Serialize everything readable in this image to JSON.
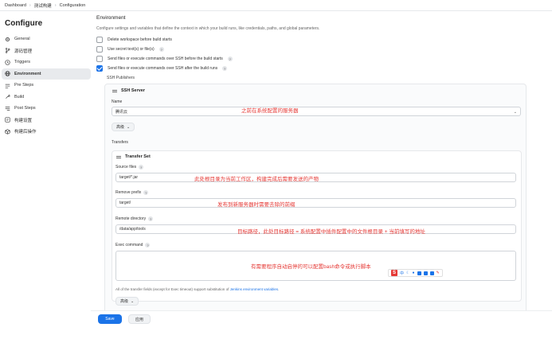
{
  "breadcrumb": [
    "Dashboard",
    "测试构建",
    "Configuration"
  ],
  "sidebar": {
    "title": "Configure",
    "items": [
      {
        "label": "General",
        "icon": "gear-icon",
        "active": false
      },
      {
        "label": "源码管理",
        "icon": "branch-icon",
        "active": false
      },
      {
        "label": "Triggers",
        "icon": "clock-icon",
        "active": false
      },
      {
        "label": "Environment",
        "icon": "globe-icon",
        "active": true
      },
      {
        "label": "Pre Steps",
        "icon": "steps-icon",
        "active": false
      },
      {
        "label": "Build",
        "icon": "build-icon",
        "active": false
      },
      {
        "label": "Post Steps",
        "icon": "post-steps-icon",
        "active": false
      },
      {
        "label": "构建设置",
        "icon": "settings-icon",
        "active": false
      },
      {
        "label": "构建后操作",
        "icon": "cube-icon",
        "active": false
      }
    ]
  },
  "environment": {
    "title": "Environment",
    "description": "Configure settings and variables that define the context in which your build runs, like credentials, paths, and global parameters.",
    "options": [
      {
        "label": "Delete workspace before build starts",
        "checked": false,
        "help": false
      },
      {
        "label": "Use secret text(s) or file(s)",
        "checked": false,
        "help": true
      },
      {
        "label": "Send files or execute commands over SSH before the build starts",
        "checked": false,
        "help": true
      },
      {
        "label": "Send files or execute commands over SSH after the build runs",
        "checked": true,
        "help": true
      }
    ],
    "ssh_publishers_label": "SSH Publishers"
  },
  "ssh_server": {
    "title": "SSH Server",
    "name_label": "Name",
    "name_value": "腾讯云",
    "advanced_label": "高级",
    "transfers_label": "Transfers",
    "name_note": "之前在系统配置的服务器"
  },
  "transfer_set": {
    "title": "Transfer Set",
    "source_files": {
      "label": "Source files",
      "value": "target/*.jar",
      "note": "此处根目录为当前工作区，构建完成后需要发送的产物"
    },
    "remove_prefix": {
      "label": "Remove prefix",
      "value": "target/",
      "note": "发布到新服务器时需要去除的前缀"
    },
    "remote_directory": {
      "label": "Remote directory",
      "value": "/data/app/tools",
      "note": "目标路径，此处目标路径 = 系统配置中插件配置中的文件根目录 + 当前填写的地址"
    },
    "exec_command": {
      "label": "Exec command",
      "value": "",
      "note": "有需要程序自动启停的可以配置bash命令或执行脚本"
    },
    "footnote_prefix": "All of the transfer fields (except for Exec timeout) support substitution of ",
    "footnote_link": "Jenkins environment variables",
    "footnote_suffix": ".",
    "advanced_label": "高级"
  },
  "ime_toolbar": {
    "logo": "S",
    "lang": "中"
  },
  "footer": {
    "save_label": "Save",
    "apply_label": "应用"
  },
  "colors": {
    "accent": "#1a73e8",
    "annotation": "#e53935"
  }
}
